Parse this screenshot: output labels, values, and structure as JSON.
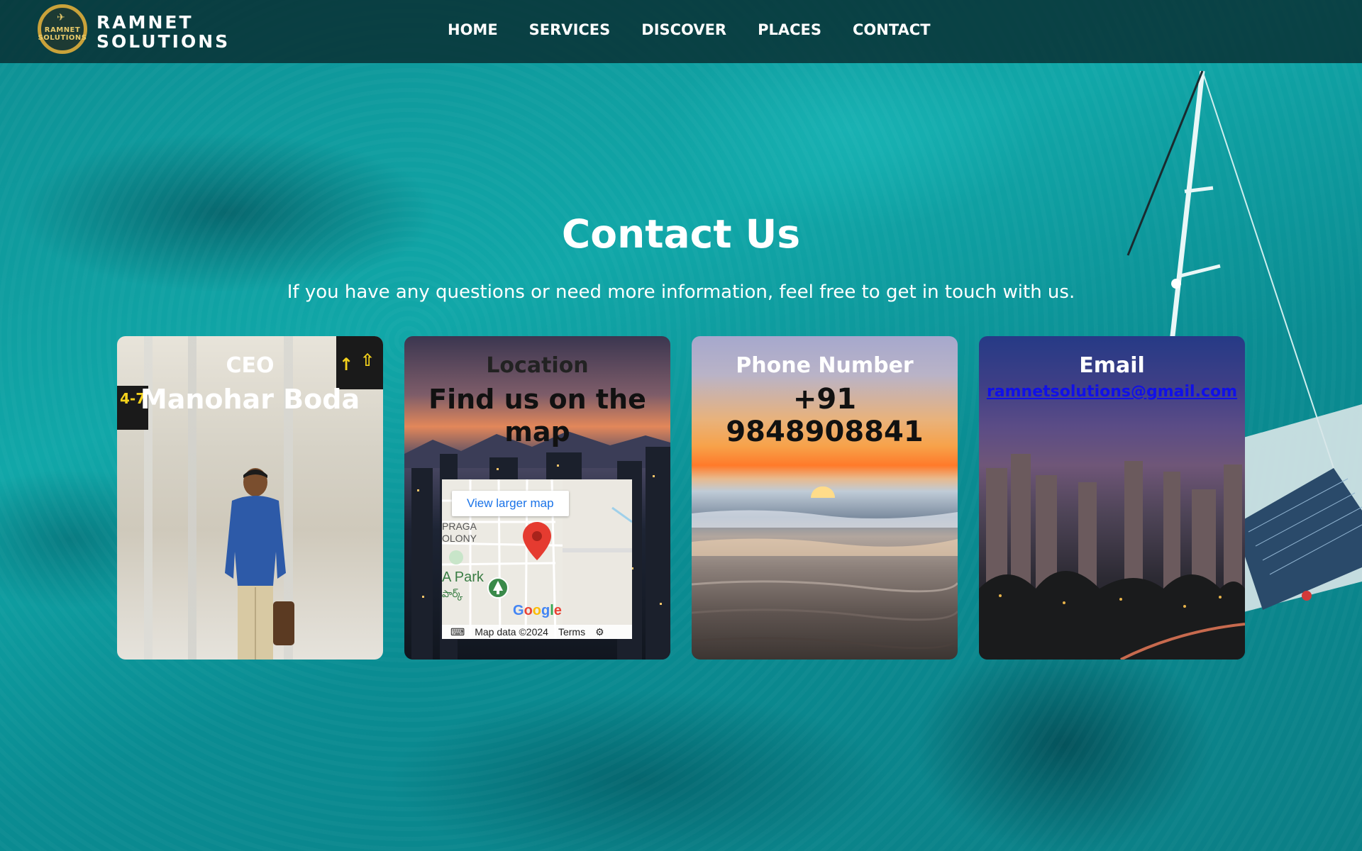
{
  "brand": {
    "line1": "RAMNET",
    "line2": "SOLUTIONS",
    "badge_text": "RAMNET\nSOLUTIONS"
  },
  "nav": {
    "items": [
      "HOME",
      "SERVICES",
      "DISCOVER",
      "PLACES",
      "CONTACT"
    ]
  },
  "page": {
    "title": "Contact Us",
    "subtitle": "If you have any questions or need more information, feel free to get in touch with us."
  },
  "cards": {
    "ceo": {
      "heading": "CEO",
      "value": "Manohar Boda"
    },
    "location": {
      "heading": "Location",
      "value": "Find us on the map",
      "map": {
        "button": "View larger map",
        "colony": "PRAGA\nOLONY",
        "park": "A Park",
        "park_local": "పార్క్",
        "logo": "Google",
        "data": "Map data ©2024",
        "terms": "Terms"
      }
    },
    "phone": {
      "heading": "Phone Number",
      "value": "+91 9848908841"
    },
    "email": {
      "heading": "Email",
      "value": "ramnetsolutions@gmail.com"
    }
  },
  "colors": {
    "accent_gold": "#c9a23a",
    "link_blue": "#1010e8",
    "nav_bg": "#08262a"
  }
}
